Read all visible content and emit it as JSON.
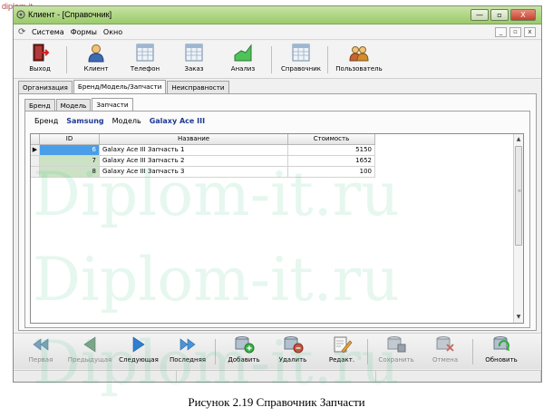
{
  "corner_mark": "diplom-it",
  "window": {
    "title": "Клиент - [Справочник]",
    "controls": [
      "—",
      "▫",
      "X"
    ]
  },
  "menu": {
    "items": [
      "Система",
      "Формы",
      "Окно"
    ],
    "mdi_controls": [
      "_",
      "▫",
      "x"
    ]
  },
  "toolbar": {
    "items": [
      {
        "label": "Выход",
        "icon": "exit-door-icon"
      },
      {
        "label": "Клиент",
        "icon": "client-person-icon"
      },
      {
        "label": "Телефон",
        "icon": "phone-table-icon"
      },
      {
        "label": "Заказ",
        "icon": "order-table-icon"
      },
      {
        "label": "Анализ",
        "icon": "analysis-chart-icon"
      },
      {
        "label": "Справочник",
        "icon": "directory-table-icon"
      },
      {
        "label": "Пользователь",
        "icon": "users-icon"
      }
    ]
  },
  "tabs_outer": [
    "Организация",
    "Бренд/Модель/Запчасти",
    "Неисправности"
  ],
  "tabs_inner": [
    "Бренд",
    "Модель",
    "Запчасти"
  ],
  "filter": {
    "brand_label": "Бренд",
    "brand_value": "Samsung",
    "model_label": "Модель",
    "model_value": "Galaxy Ace III"
  },
  "grid": {
    "columns": [
      "ID",
      "Название",
      "Стоимость"
    ],
    "rows": [
      {
        "id": "6",
        "name": "Galaxy Ace III Запчасть 1",
        "cost": "5150",
        "selected": true
      },
      {
        "id": "7",
        "name": "Galaxy Ace III Запчасть 2",
        "cost": "1652",
        "selected": false
      },
      {
        "id": "8",
        "name": "Galaxy Ace III Запчасть 3",
        "cost": "100",
        "selected": false
      }
    ],
    "row_indicator": "▶",
    "scroll_up": "▲",
    "scroll_down": "▼"
  },
  "navbar": {
    "items": [
      {
        "label": "Первая",
        "icon": "first-record-icon",
        "enabled": false
      },
      {
        "label": "Предыдущая",
        "icon": "previous-record-icon",
        "enabled": false
      },
      {
        "label": "Следующая",
        "icon": "next-record-icon",
        "enabled": true
      },
      {
        "label": "Последняя",
        "icon": "last-record-icon",
        "enabled": true
      },
      {
        "label": "Добавить",
        "icon": "add-db-icon",
        "enabled": true
      },
      {
        "label": "Удалить",
        "icon": "delete-db-icon",
        "enabled": true
      },
      {
        "label": "Редакт.",
        "icon": "edit-icon",
        "enabled": true
      },
      {
        "label": "Сохранить",
        "icon": "save-db-icon",
        "enabled": false
      },
      {
        "label": "Отмена",
        "icon": "cancel-db-icon",
        "enabled": false
      },
      {
        "label": "Обновить",
        "icon": "refresh-icon",
        "enabled": true
      }
    ]
  },
  "caption": "Рисунок 2.19 Справочник Запчасти",
  "watermark": "Diplom-it.ru",
  "colors": {
    "title_green": "#9bca6a",
    "selected_cell": "#4a9de8",
    "id_cell": "#cbe3c4",
    "filter_value": "#1f3a93"
  }
}
